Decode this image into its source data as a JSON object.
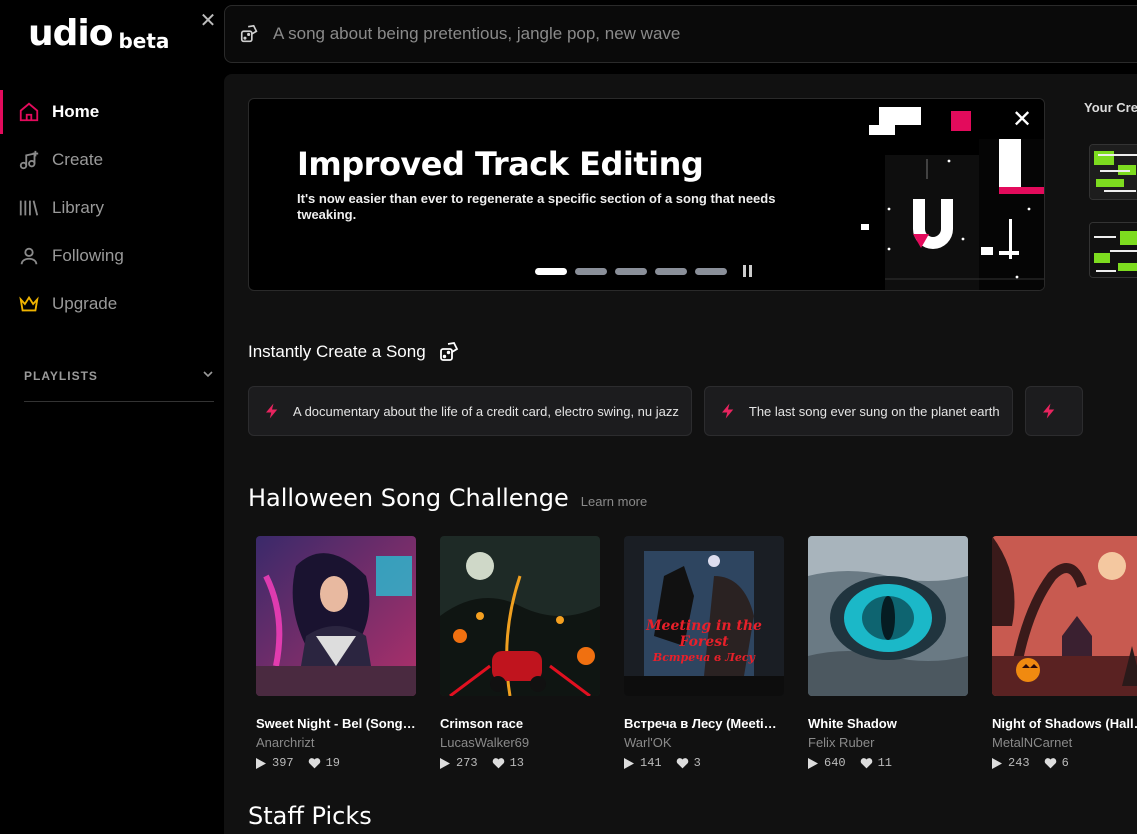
{
  "app": {
    "logo": "udio",
    "logo_badge": "beta"
  },
  "sidebar": {
    "items": [
      {
        "label": "Home",
        "icon": "home-icon",
        "active": true
      },
      {
        "label": "Create",
        "icon": "music-plus-icon",
        "active": false
      },
      {
        "label": "Library",
        "icon": "library-icon",
        "active": false
      },
      {
        "label": "Following",
        "icon": "user-icon",
        "active": false
      },
      {
        "label": "Upgrade",
        "icon": "crown-icon",
        "active": false
      }
    ],
    "playlists_label": "PLAYLISTS"
  },
  "search": {
    "placeholder": "A song about being pretentious, jangle pop, new wave"
  },
  "banner": {
    "title": "Improved Track Editing",
    "description": "It's now easier than ever to regenerate a specific section of a song that needs tweaking.",
    "slides": 5,
    "active_slide": 1
  },
  "your_creations_label": "Your Cre",
  "instant": {
    "title": "Instantly Create a Song",
    "chips": [
      "A documentary about the life of a credit card, electro swing, nu jazz",
      "The last song ever sung on the planet earth",
      ""
    ]
  },
  "challenge": {
    "title": "Halloween Song Challenge",
    "learn_more": "Learn more",
    "songs": [
      {
        "title": "Sweet Night - Bel (Song for Halloween)",
        "artist": "Anarchrizt",
        "plays": "397",
        "likes": "19"
      },
      {
        "title": "Crimson race",
        "artist": "LucasWalker69",
        "plays": "273",
        "likes": "13"
      },
      {
        "title": "Встреча в Лесу (Meeting in the Forest)",
        "artist": "Warl'OK",
        "plays": "141",
        "likes": "3",
        "art_text_1": "Meeting in the Forest",
        "art_text_2": "Встреча в Лесу"
      },
      {
        "title": "White Shadow",
        "artist": "Felix Ruber",
        "plays": "640",
        "likes": "11"
      },
      {
        "title": "Night of Shadows (Halloween)",
        "artist": "MetalNCarnet",
        "plays": "243",
        "likes": "6"
      }
    ]
  },
  "staff_picks": {
    "title": "Staff Picks"
  },
  "colors": {
    "accent": "#e30b5c",
    "crown": "#f0b400",
    "chip_bolt": "#e8245f"
  }
}
